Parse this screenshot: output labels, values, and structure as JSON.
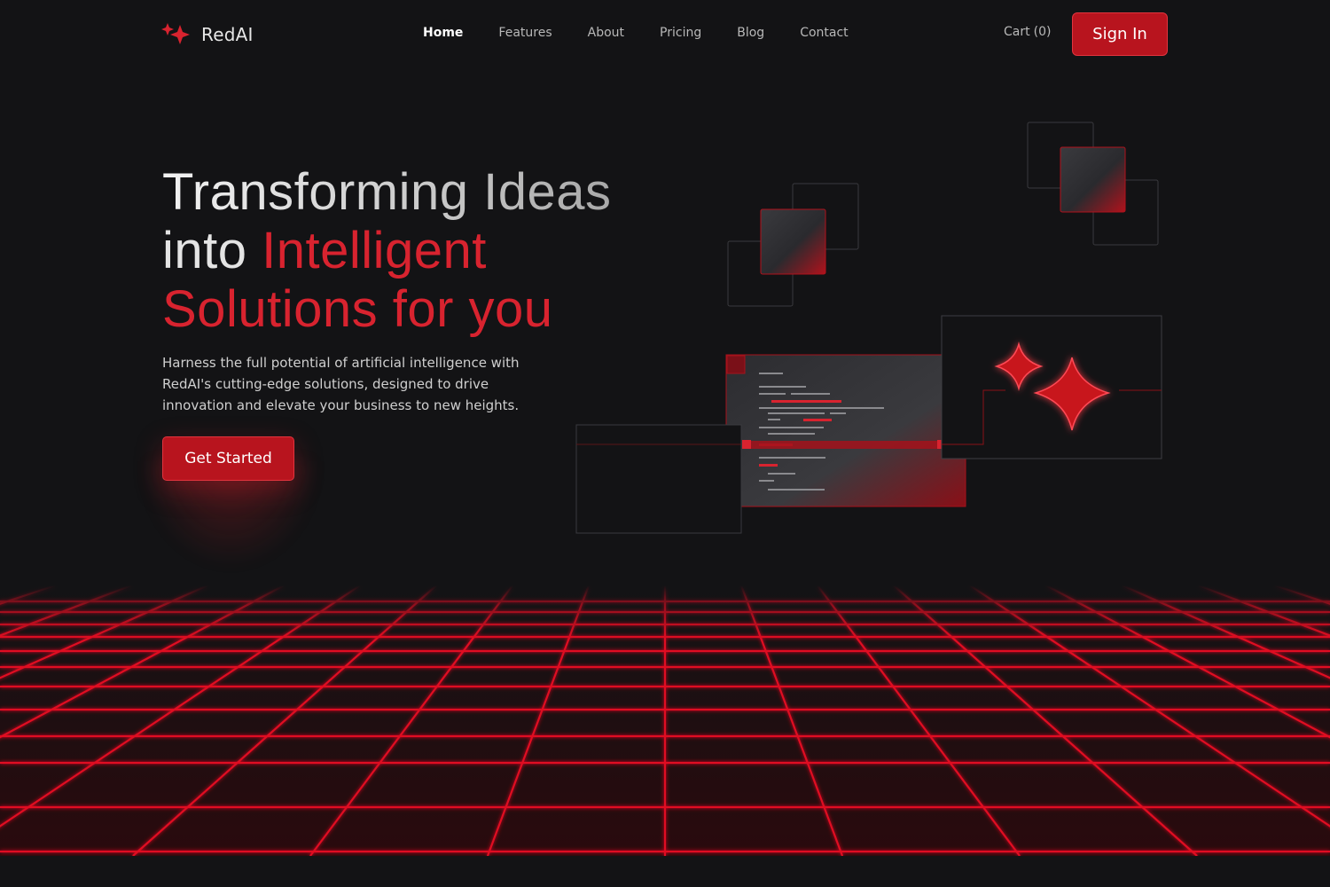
{
  "brand": {
    "name": "RedAI",
    "logo_icon": "sparkle-icon",
    "accent": "#d8232f"
  },
  "nav": {
    "links": [
      {
        "label": "Home",
        "active": true
      },
      {
        "label": "Features",
        "active": false
      },
      {
        "label": "About",
        "active": false
      },
      {
        "label": "Pricing",
        "active": false
      },
      {
        "label": "Blog",
        "active": false
      },
      {
        "label": "Contact",
        "active": false
      }
    ],
    "cart_label": "Cart",
    "cart_count": "(0)",
    "signin_label": "Sign In"
  },
  "hero": {
    "title_line1": "Transforming Ideas",
    "title_line2_plain": "into ",
    "title_line2_accent": "Intelligent",
    "title_line3": "Solutions for you",
    "description": "Harness the full potential of artificial intelligence with RedAI's cutting-edge solutions, designed to drive innovation and elevate your business to new heights.",
    "cta_label": "Get Started"
  },
  "colors": {
    "background": "#131315",
    "button": "#b8141e",
    "grid": "#e01020"
  }
}
